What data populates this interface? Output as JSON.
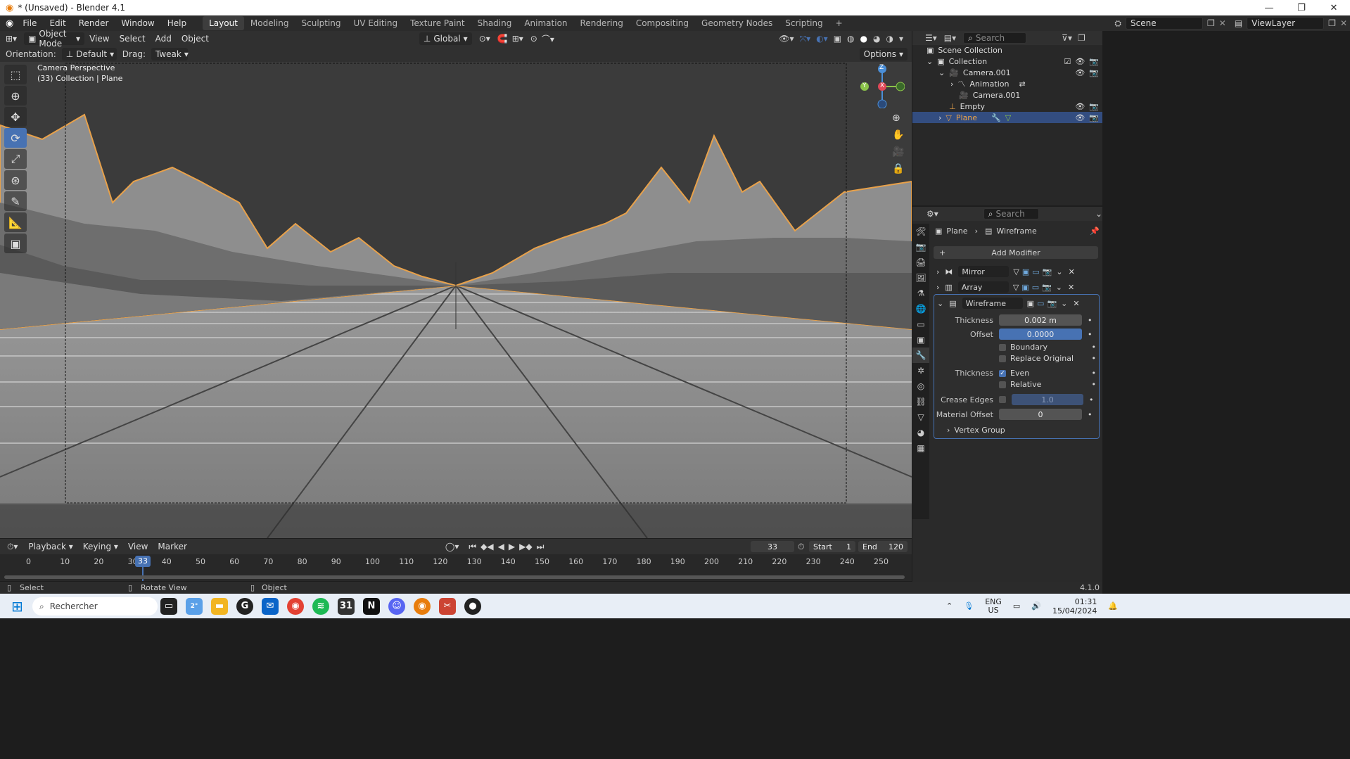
{
  "titlebar": {
    "title": "* (Unsaved) - Blender 4.1",
    "min": "—",
    "max": "❐",
    "close": "✕"
  },
  "menu": [
    "File",
    "Edit",
    "Render",
    "Window",
    "Help"
  ],
  "workspaces": [
    "Layout",
    "Modeling",
    "Sculpting",
    "UV Editing",
    "Texture Paint",
    "Shading",
    "Animation",
    "Rendering",
    "Compositing",
    "Geometry Nodes",
    "Scripting"
  ],
  "active_workspace": "Layout",
  "scene": {
    "name": "Scene",
    "view_layer": "ViewLayer"
  },
  "viewport_header": {
    "mode": "Object Mode",
    "menus": [
      "View",
      "Select",
      "Add",
      "Object"
    ],
    "transform": "Global",
    "orientation_label": "Orientation:",
    "orientation_value": "Default",
    "drag_label": "Drag:",
    "drag_value": "Tweak",
    "options": "Options"
  },
  "viewport_overlay": {
    "line1": "Camera Perspective",
    "line2": "(33) Collection | Plane"
  },
  "gizmo": {
    "z": "Z",
    "y": "Y",
    "x": "X"
  },
  "outliner": {
    "search_placeholder": "Search",
    "items": {
      "scene_collection": "Scene Collection",
      "collection": "Collection",
      "camera": "Camera.001",
      "animation": "Animation",
      "camera_data": "Camera.001",
      "empty": "Empty",
      "plane": "Plane"
    }
  },
  "properties": {
    "search_placeholder": "Search",
    "breadcrumb_object": "Plane",
    "breadcrumb_modifier": "Wireframe",
    "add_modifier": "Add Modifier",
    "modifiers": [
      "Mirror",
      "Array",
      "Wireframe"
    ],
    "wireframe": {
      "thickness_label": "Thickness",
      "thickness_value": "0.002 m",
      "offset_label": "Offset",
      "offset_value": "0.0000",
      "boundary": "Boundary",
      "replace_original": "Replace Original",
      "thickness2_label": "Thickness",
      "even": "Even",
      "relative": "Relative",
      "crease_label": "Crease Edges",
      "crease_value": "1.0",
      "material_offset_label": "Material Offset",
      "material_offset_value": "0",
      "vertex_group": "Vertex Group"
    }
  },
  "timeline": {
    "menus": [
      "Playback",
      "Keying",
      "View",
      "Marker"
    ],
    "current_frame": "33",
    "start_label": "Start",
    "start_value": "1",
    "end_label": "End",
    "end_value": "120",
    "ticks": [
      "0",
      "10",
      "20",
      "30",
      "40",
      "50",
      "60",
      "70",
      "80",
      "90",
      "100",
      "110",
      "120",
      "130",
      "140",
      "150",
      "160",
      "170",
      "180",
      "190",
      "200",
      "210",
      "220",
      "230",
      "240",
      "250"
    ],
    "playhead": "33"
  },
  "statusbar": {
    "select": "Select",
    "rotate": "Rotate View",
    "object": "Object",
    "version": "4.1.0"
  },
  "taskbar": {
    "search_placeholder": "Rechercher",
    "weather": "2°",
    "lang1": "ENG",
    "lang2": "US",
    "time": "01:31",
    "date": "15/04/2024"
  }
}
